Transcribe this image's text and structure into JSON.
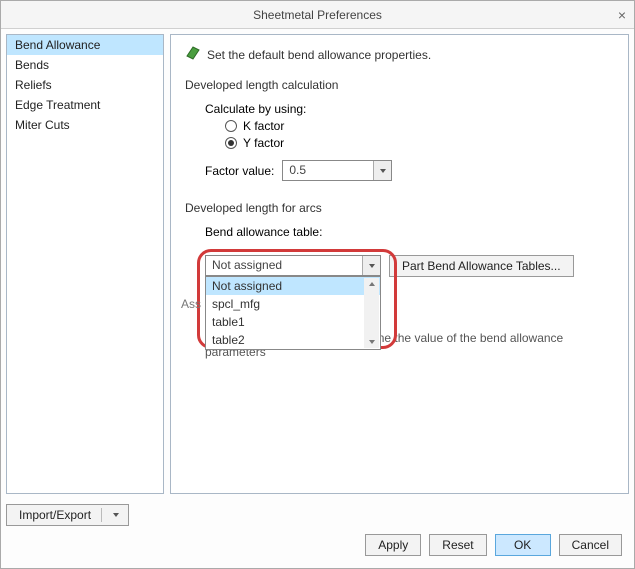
{
  "title": "Sheetmetal Preferences",
  "sidebar": {
    "items": [
      {
        "label": "Bend Allowance",
        "selected": true
      },
      {
        "label": "Bends"
      },
      {
        "label": "Reliefs"
      },
      {
        "label": "Edge Treatment"
      },
      {
        "label": "Miter Cuts"
      }
    ]
  },
  "header_text": "Set the default bend allowance properties.",
  "section1": {
    "title": "Developed length calculation",
    "calc_label": "Calculate by using:",
    "radio_k": "K factor",
    "radio_y": "Y factor",
    "factor_label": "Factor value:",
    "factor_value": "0.5"
  },
  "section2": {
    "title": "Developed length for arcs",
    "combo_label": "Bend allowance table:",
    "combo_value": "Not assigned",
    "options": [
      "Not assigned",
      "spcl_mfg",
      "table1",
      "table2"
    ],
    "button_label": "Part Bend Allowance Tables...",
    "assign_hint_prefix": "Ass",
    "cb_label_visible": "Use assigned material to define the value of the bend allowance parameters"
  },
  "footer": {
    "import_export": "Import/Export",
    "apply": "Apply",
    "reset": "Reset",
    "ok": "OK",
    "cancel": "Cancel"
  }
}
